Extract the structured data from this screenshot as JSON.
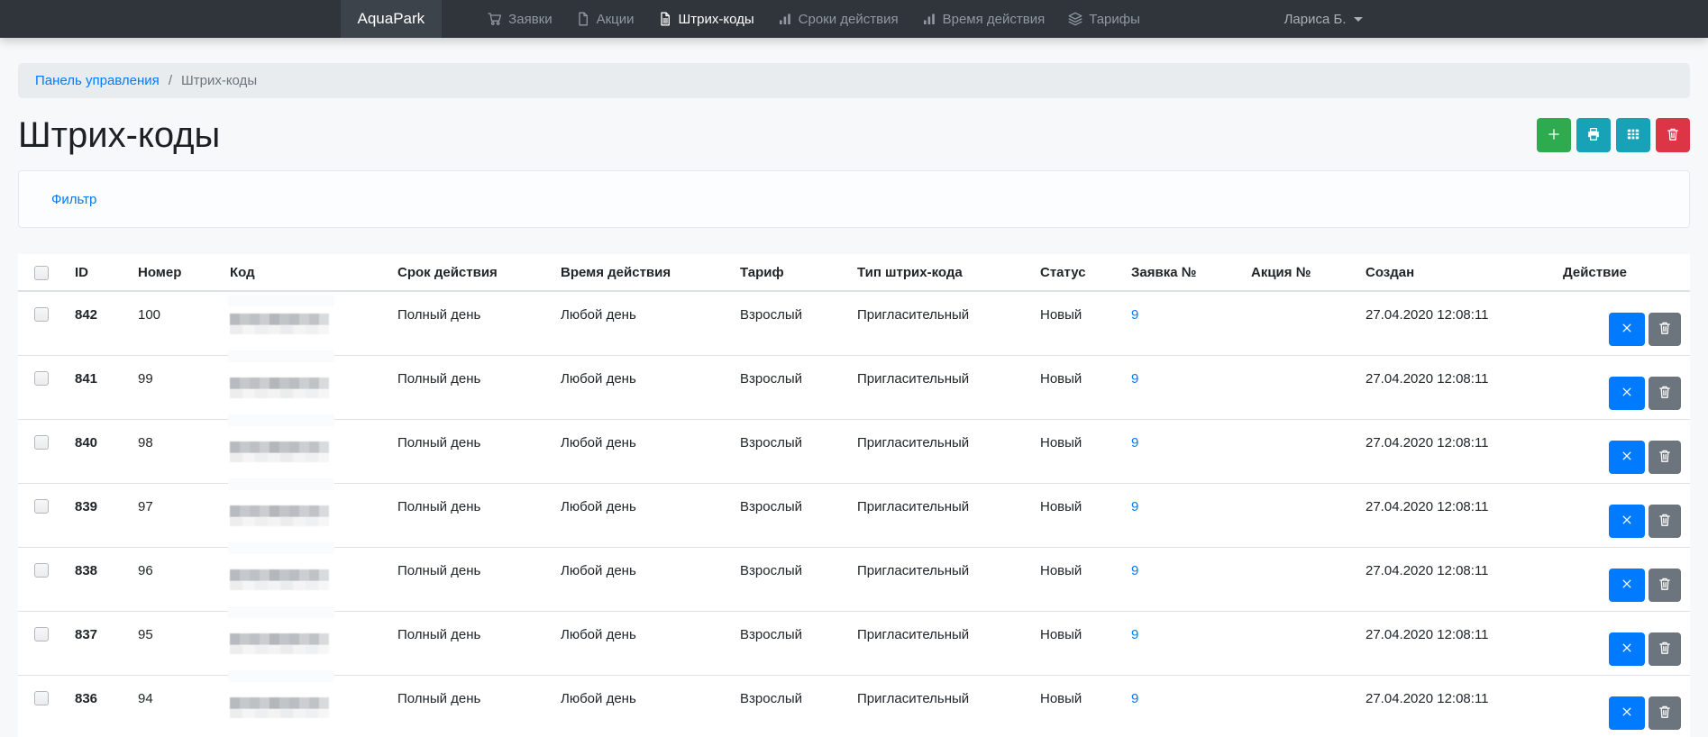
{
  "navbar": {
    "brand": "AquaPark",
    "items": [
      {
        "label": "Заявки",
        "icon": "cart-icon",
        "active": false
      },
      {
        "label": "Акции",
        "icon": "file-icon",
        "active": false
      },
      {
        "label": "Штрих-коды",
        "icon": "file-text-icon",
        "active": true
      },
      {
        "label": "Сроки действия",
        "icon": "bar-chart-icon",
        "active": false
      },
      {
        "label": "Время действия",
        "icon": "bar-chart-icon",
        "active": false
      },
      {
        "label": "Тарифы",
        "icon": "layers-icon",
        "active": false
      }
    ],
    "user_name": "Лариса Б."
  },
  "breadcrumb": {
    "root": "Панель управления",
    "separator": "/",
    "current": "Штрих-коды"
  },
  "page": {
    "title": "Штрих-коды"
  },
  "toolbar": {
    "buttons": [
      {
        "name": "add-button",
        "icon": "plus-icon",
        "color": "#2eaa4f"
      },
      {
        "name": "print-button",
        "icon": "printer-icon",
        "color": "#17a2b8"
      },
      {
        "name": "columns-button",
        "icon": "grid-icon",
        "color": "#17a2b8"
      },
      {
        "name": "delete-button",
        "icon": "trash-icon",
        "color": "#dc3545"
      }
    ]
  },
  "filter": {
    "toggle_label": "Фильтр"
  },
  "table": {
    "headers": [
      "ID",
      "Номер",
      "Код",
      "Срок действия",
      "Время действия",
      "Тариф",
      "Тип штрих-кода",
      "Статус",
      "Заявка №",
      "Акция №",
      "Создан",
      "Действие"
    ],
    "row_actions": [
      {
        "name": "cancel-barcode-button",
        "icon": "x-icon",
        "style": "primary",
        "color": "#007bff"
      },
      {
        "name": "delete-row-button",
        "icon": "trash-icon",
        "style": "secondary",
        "color": "#6c757d"
      }
    ],
    "rows": [
      {
        "id": "842",
        "number": "100",
        "code_censored": true,
        "term": "Полный день",
        "time": "Любой день",
        "tariff": "Взрослый",
        "type": "Пригласительный",
        "status": "Новый",
        "request_no": "9",
        "promo_no": "",
        "created": "27.04.2020 12:08:11"
      },
      {
        "id": "841",
        "number": "99",
        "code_censored": true,
        "term": "Полный день",
        "time": "Любой день",
        "tariff": "Взрослый",
        "type": "Пригласительный",
        "status": "Новый",
        "request_no": "9",
        "promo_no": "",
        "created": "27.04.2020 12:08:11"
      },
      {
        "id": "840",
        "number": "98",
        "code_censored": true,
        "term": "Полный день",
        "time": "Любой день",
        "tariff": "Взрослый",
        "type": "Пригласительный",
        "status": "Новый",
        "request_no": "9",
        "promo_no": "",
        "created": "27.04.2020 12:08:11"
      },
      {
        "id": "839",
        "number": "97",
        "code_censored": true,
        "term": "Полный день",
        "time": "Любой день",
        "tariff": "Взрослый",
        "type": "Пригласительный",
        "status": "Новый",
        "request_no": "9",
        "promo_no": "",
        "created": "27.04.2020 12:08:11"
      },
      {
        "id": "838",
        "number": "96",
        "code_censored": true,
        "term": "Полный день",
        "time": "Любой день",
        "tariff": "Взрослый",
        "type": "Пригласительный",
        "status": "Новый",
        "request_no": "9",
        "promo_no": "",
        "created": "27.04.2020 12:08:11"
      },
      {
        "id": "837",
        "number": "95",
        "code_censored": true,
        "term": "Полный день",
        "time": "Любой день",
        "tariff": "Взрослый",
        "type": "Пригласительный",
        "status": "Новый",
        "request_no": "9",
        "promo_no": "",
        "created": "27.04.2020 12:08:11"
      },
      {
        "id": "836",
        "number": "94",
        "code_censored": true,
        "term": "Полный день",
        "time": "Любой день",
        "tariff": "Взрослый",
        "type": "Пригласительный",
        "status": "Новый",
        "request_no": "9",
        "promo_no": "",
        "created": "27.04.2020 12:08:11"
      }
    ]
  },
  "colors": {
    "navbar_bg": "#2f353b",
    "brand_bg": "#3d434a",
    "link_blue": "#007bff",
    "success_green": "#2eaa4f",
    "info_teal": "#17a2b8",
    "danger_red": "#dc3545",
    "secondary_gray": "#6c757d",
    "breadcrumb_bg": "#e9ecef",
    "border_gray": "#dee2e6"
  }
}
